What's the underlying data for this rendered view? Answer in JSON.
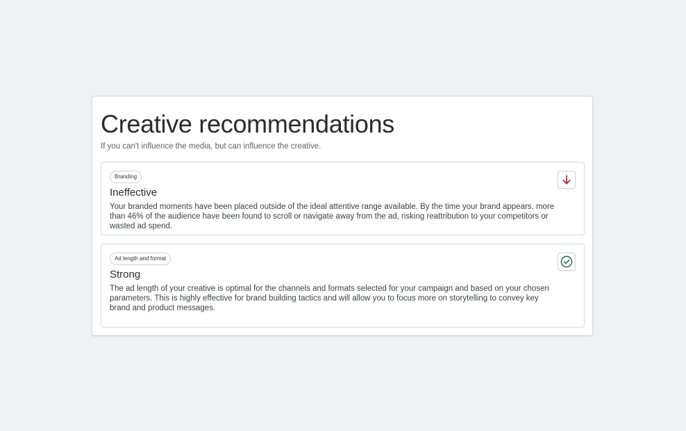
{
  "page": {
    "title": "Creative recommendations",
    "subtitle": "If you can't influence the media, but can influence the creative."
  },
  "recommendations": [
    {
      "category": "Branding",
      "status": "Ineffective",
      "description": "Your branded moments have been placed outside of the ideal attentive range available. By the time your brand appears, more than 46% of the audience have been found to scroll or navigate away from the ad, risking reattribution to your competitors or wasted ad spend.",
      "icon": "arrow-down-icon",
      "icon_color": "#b3122e"
    },
    {
      "category": "Ad length and format",
      "status": "Strong",
      "description": "The ad length of your creative is optimal for the channels and formats selected for your campaign and based on your chosen parameters. This is highly effective for brand building tactics and will allow you to focus more on storytelling to convey key brand and product messages.",
      "icon": "check-circle-icon",
      "icon_color": "#1e6b4f"
    }
  ]
}
